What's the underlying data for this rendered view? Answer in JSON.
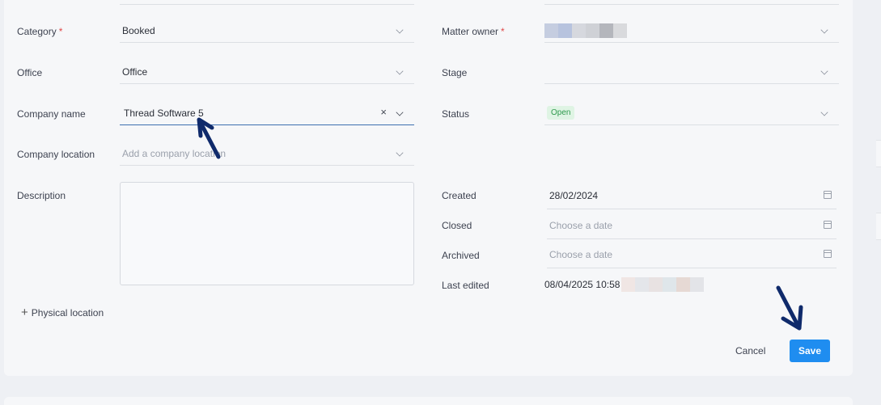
{
  "form": {
    "left": {
      "category": {
        "label": "Category",
        "required": "*",
        "value": "Booked"
      },
      "office": {
        "label": "Office",
        "value": "Office"
      },
      "company_name": {
        "label": "Company name",
        "value": "Thread Software 5",
        "clear": "×"
      },
      "company_location": {
        "label": "Company location",
        "placeholder": "Add a company location"
      },
      "description": {
        "label": "Description"
      }
    },
    "right": {
      "matter_owner": {
        "label": "Matter owner",
        "required": "*"
      },
      "stage": {
        "label": "Stage"
      },
      "status": {
        "label": "Status",
        "value": "Open"
      },
      "created": {
        "label": "Created",
        "value": "28/02/2024"
      },
      "closed": {
        "label": "Closed",
        "placeholder": "Choose a date"
      },
      "archived": {
        "label": "Archived",
        "placeholder": "Choose a date"
      },
      "last_edited": {
        "label": "Last edited",
        "value": "08/04/2025 10:58"
      }
    },
    "physical_location": {
      "label": "Physical location",
      "icon": "plus-icon"
    },
    "actions": {
      "cancel_label": "Cancel",
      "save_label": "Save"
    }
  },
  "colors": {
    "accent": "#1f8df0",
    "status_bg": "#dff4e4",
    "status_text": "#2e9a4c",
    "required": "#e04848"
  }
}
